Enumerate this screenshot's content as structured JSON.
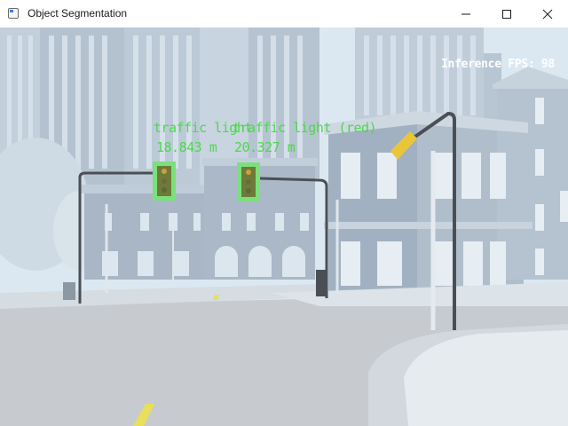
{
  "window": {
    "title": "Object Segmentation",
    "icon": "app-window-icon",
    "controls": [
      "minimize-icon",
      "maximize-icon",
      "close-icon"
    ]
  },
  "overlay": {
    "fps_text": "Inference FPS: 98"
  },
  "detections": [
    {
      "label": "traffic light",
      "distance": "18.843 m",
      "color": "#4cd94c"
    },
    {
      "label": "traffic light (red)",
      "distance": "20.327 m",
      "color": "#4cd94c"
    }
  ],
  "colors": {
    "sky": "#dbe8f1",
    "building": "#a9b7c6",
    "road": "#c9ccd0",
    "detection": "#4cd94c",
    "mask": "#7be07b"
  }
}
